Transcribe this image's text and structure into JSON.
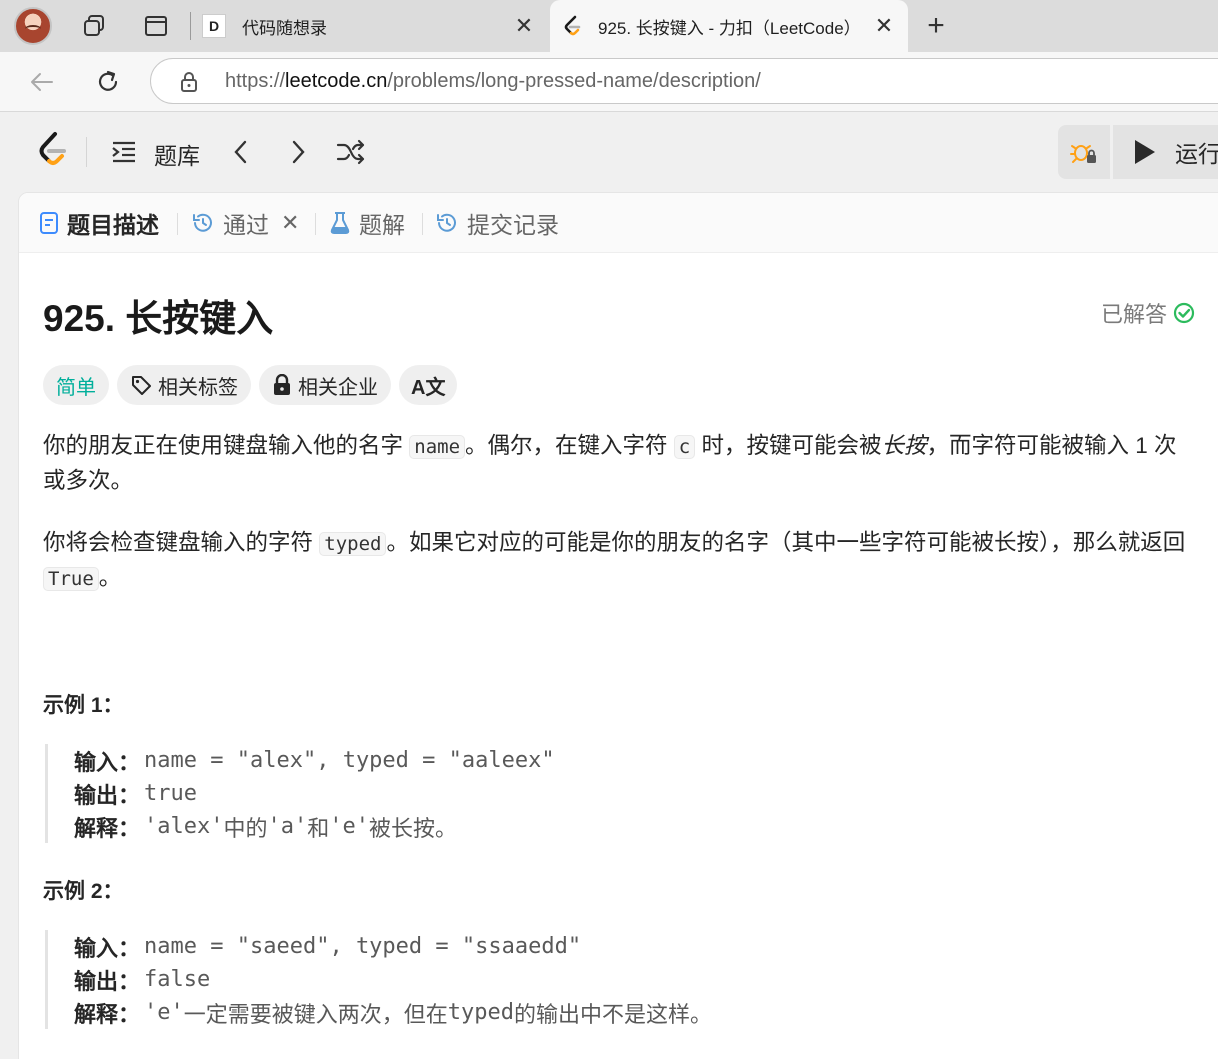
{
  "browser": {
    "tabs": [
      {
        "title": "代码随想录",
        "favicon_text": "D"
      },
      {
        "title": "925. 长按键入 - 力扣（LeetCode）"
      }
    ],
    "url_scheme": "https://",
    "url_domain": "leetcode.cn",
    "url_path": "/problems/long-pressed-name/description/"
  },
  "header": {
    "problem_list_label": "题库",
    "run_label": "运行"
  },
  "panel_tabs": [
    {
      "label": "题目描述"
    },
    {
      "label": "通过"
    },
    {
      "label": "题解"
    },
    {
      "label": "提交记录"
    }
  ],
  "problem": {
    "title": "925. 长按键入",
    "status": "已解答",
    "difficulty": "简单",
    "tag_topics": "相关标签",
    "tag_companies": "相关企业",
    "tag_translate": "A文",
    "p1_a": "你的朋友正在使用键盘输入他的名字 ",
    "p1_code1": "name",
    "p1_b": "。偶尔，在键入字符 ",
    "p1_code2": "c",
    "p1_c": " 时，按键可能会被",
    "p1_em": "长按",
    "p1_d": "，而字符可能被输入 1 次或多次。",
    "p2_a": "你将会检查键盘输入的字符 ",
    "p2_code1": "typed",
    "p2_b": "。如果它对应的可能是你的朋友的名字（其中一些字符可能被长按），那么就返回 ",
    "p2_code2": "True",
    "p2_c": "。"
  },
  "examples": [
    {
      "title": "示例 1：",
      "input_label": "输入：",
      "input": "name = \"alex\", typed = \"aaleex\"",
      "output_label": "输出：",
      "output": "true",
      "explain_label": "解释：",
      "explain_code1": "'alex'",
      "explain_t1": " 中的 ",
      "explain_code2": "'a'",
      "explain_t2": " 和 ",
      "explain_code3": "'e'",
      "explain_t3": " 被长按。"
    },
    {
      "title": "示例 2：",
      "input_label": "输入：",
      "input": "name = \"saeed\", typed = \"ssaaedd\"",
      "output_label": "输出：",
      "output": "false",
      "explain_label": "解释：",
      "explain_code1": "'e'",
      "explain_t1": " 一定需要被键入两次，但在 ",
      "explain_code2": "typed",
      "explain_t2": " 的输出中不是这样。"
    }
  ],
  "colors": {
    "easy": "#00af9b",
    "solved_check": "#2cbb5d",
    "lc_orange": "#ffa116",
    "tab_icon_blue": "#5b9bd5"
  },
  "icons": [
    "avatar",
    "workspaces-icon",
    "tab-actions-icon",
    "close-icon",
    "new-tab-icon",
    "back-icon",
    "refresh-icon",
    "lock-icon",
    "leetcode-logo",
    "problem-list-icon",
    "chevron-left-icon",
    "chevron-right-icon",
    "shuffle-icon",
    "debug-icon",
    "play-icon",
    "description-icon",
    "history-icon",
    "flask-icon",
    "check-circle-icon",
    "tag-icon",
    "lock-icon"
  ]
}
